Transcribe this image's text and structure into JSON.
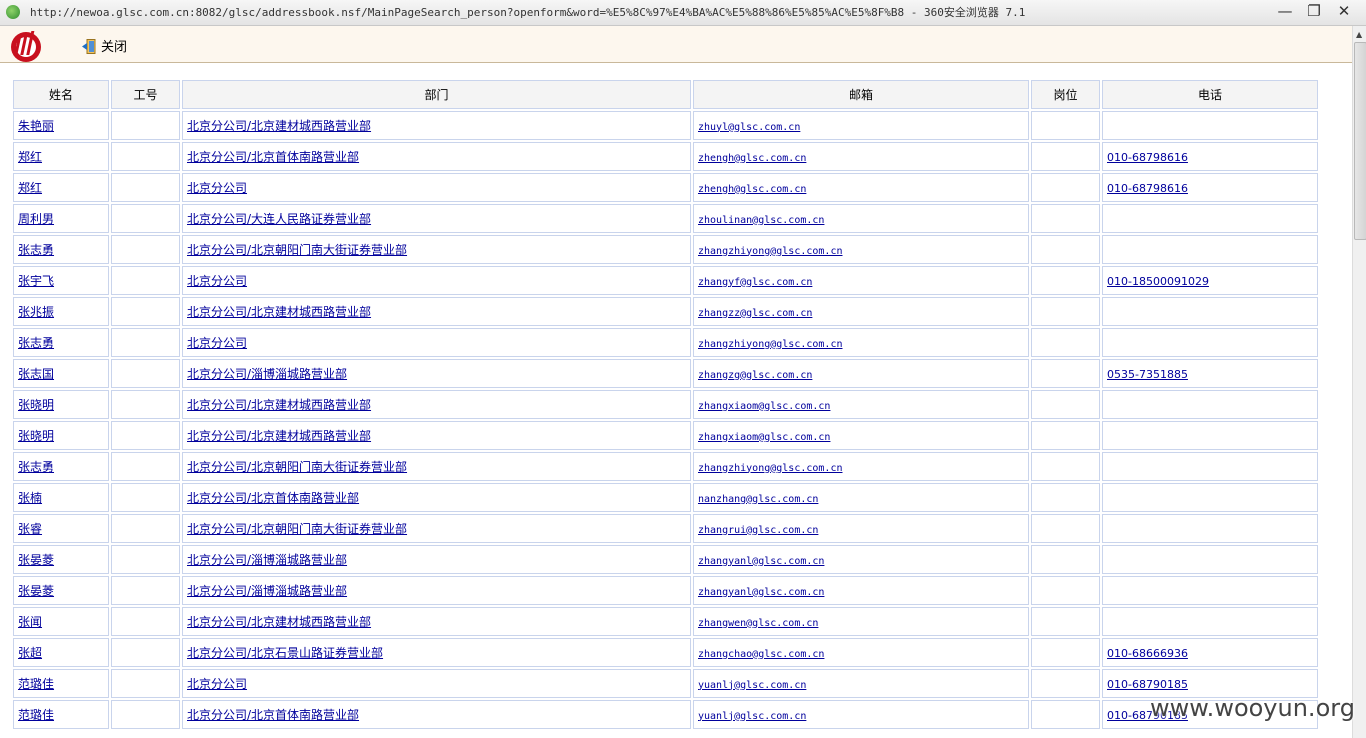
{
  "window": {
    "title": "http://newoa.glsc.com.cn:8082/glsc/addressbook.nsf/MainPageSearch_person?openform&word=%E5%8C%97%E4%BA%AC%E5%88%86%E5%85%AC%E5%8F%B8 - 360安全浏览器 7.1",
    "minimize": "—",
    "maximize": "❐",
    "close": "✕"
  },
  "toolbar": {
    "close_label": "关闭"
  },
  "table": {
    "headers": [
      "姓名",
      "工号",
      "部门",
      "邮箱",
      "岗位",
      "电话"
    ],
    "rows": [
      {
        "name": "朱艳丽",
        "id": "",
        "dept": "北京分公司/北京建材城西路营业部",
        "email": "zhuyl@glsc.com.cn",
        "post": "",
        "phone": ""
      },
      {
        "name": "郑红",
        "id": "",
        "dept": "北京分公司/北京首体南路营业部",
        "email": "zhengh@glsc.com.cn",
        "post": "",
        "phone": "010-68798616"
      },
      {
        "name": "郑红",
        "id": "",
        "dept": "北京分公司",
        "email": "zhengh@glsc.com.cn",
        "post": "",
        "phone": "010-68798616"
      },
      {
        "name": "周利男",
        "id": "",
        "dept": "北京分公司/大连人民路证券营业部",
        "email": "zhoulinan@glsc.com.cn",
        "post": "",
        "phone": ""
      },
      {
        "name": "张志勇",
        "id": "",
        "dept": "北京分公司/北京朝阳门南大街证券营业部",
        "email": "zhangzhiyong@glsc.com.cn",
        "post": "",
        "phone": ""
      },
      {
        "name": "张宇飞",
        "id": "",
        "dept": "北京分公司",
        "email": "zhangyf@glsc.com.cn",
        "post": "",
        "phone": "010-18500091029"
      },
      {
        "name": "张兆振",
        "id": "",
        "dept": "北京分公司/北京建材城西路营业部",
        "email": "zhangzz@glsc.com.cn",
        "post": "",
        "phone": ""
      },
      {
        "name": "张志勇",
        "id": "",
        "dept": "北京分公司",
        "email": "zhangzhiyong@glsc.com.cn",
        "post": "",
        "phone": ""
      },
      {
        "name": "张志国",
        "id": "",
        "dept": "北京分公司/淄博淄城路营业部",
        "email": "zhangzg@glsc.com.cn",
        "post": "",
        "phone": "0535-7351885"
      },
      {
        "name": "张晓明",
        "id": "",
        "dept": "北京分公司/北京建材城西路营业部",
        "email": "zhangxiaom@glsc.com.cn",
        "post": "",
        "phone": ""
      },
      {
        "name": "张晓明",
        "id": "",
        "dept": "北京分公司/北京建材城西路营业部",
        "email": "zhangxiaom@glsc.com.cn",
        "post": "",
        "phone": ""
      },
      {
        "name": "张志勇",
        "id": "",
        "dept": "北京分公司/北京朝阳门南大街证券营业部",
        "email": "zhangzhiyong@glsc.com.cn",
        "post": "",
        "phone": ""
      },
      {
        "name": "张楠",
        "id": "",
        "dept": "北京分公司/北京首体南路营业部",
        "email": "nanzhang@glsc.com.cn",
        "post": "",
        "phone": ""
      },
      {
        "name": "张睿",
        "id": "",
        "dept": "北京分公司/北京朝阳门南大街证券营业部",
        "email": "zhangrui@glsc.com.cn",
        "post": "",
        "phone": ""
      },
      {
        "name": "张晏菱",
        "id": "",
        "dept": "北京分公司/淄博淄城路营业部",
        "email": "zhangyanl@glsc.com.cn",
        "post": "",
        "phone": ""
      },
      {
        "name": "张晏菱",
        "id": "",
        "dept": "北京分公司/淄博淄城路营业部",
        "email": "zhangyanl@glsc.com.cn",
        "post": "",
        "phone": ""
      },
      {
        "name": "张闻",
        "id": "",
        "dept": "北京分公司/北京建材城西路营业部",
        "email": "zhangwen@glsc.com.cn",
        "post": "",
        "phone": ""
      },
      {
        "name": "张超",
        "id": "",
        "dept": "北京分公司/北京石景山路证券营业部",
        "email": "zhangchao@glsc.com.cn",
        "post": "",
        "phone": "010-68666936"
      },
      {
        "name": "范璐佳",
        "id": "",
        "dept": "北京分公司",
        "email": "yuanlj@glsc.com.cn",
        "post": "",
        "phone": "010-68790185"
      },
      {
        "name": "范璐佳",
        "id": "",
        "dept": "北京分公司/北京首体南路营业部",
        "email": "yuanlj@glsc.com.cn",
        "post": "",
        "phone": "010-68790185"
      }
    ]
  },
  "watermark": "www.wooyun.org",
  "colors": {
    "link": "#00009c",
    "cell_border": "#c9d4ec",
    "toolbar_bg": "#fdf7ee",
    "logo_red": "#c8101e"
  }
}
